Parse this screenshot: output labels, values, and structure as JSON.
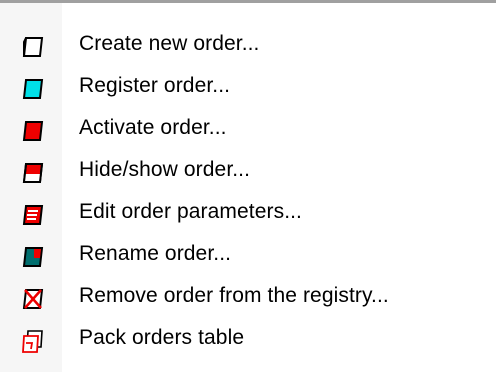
{
  "menu": {
    "items": [
      {
        "label": "Create new order...",
        "icon": "new-order-icon",
        "fill": "#ffffff"
      },
      {
        "label": "Register order...",
        "icon": "register-order-icon",
        "fill": "#00e0e8"
      },
      {
        "label": "Activate order...",
        "icon": "activate-order-icon",
        "fill": "#ee0000"
      },
      {
        "label": "Hide/show order...",
        "icon": "hide-show-order-icon",
        "fill": "#ee0000"
      },
      {
        "label": "Edit order parameters...",
        "icon": "edit-parameters-icon",
        "fill": "#ee0000"
      },
      {
        "label": "Rename order...",
        "icon": "rename-order-icon",
        "fill": "#006e6e"
      },
      {
        "label": "Remove order from the registry...",
        "icon": "remove-order-icon",
        "fill": "#ee0000"
      },
      {
        "label": "Pack orders table",
        "icon": "pack-table-icon",
        "fill": "#ee0000"
      }
    ]
  }
}
